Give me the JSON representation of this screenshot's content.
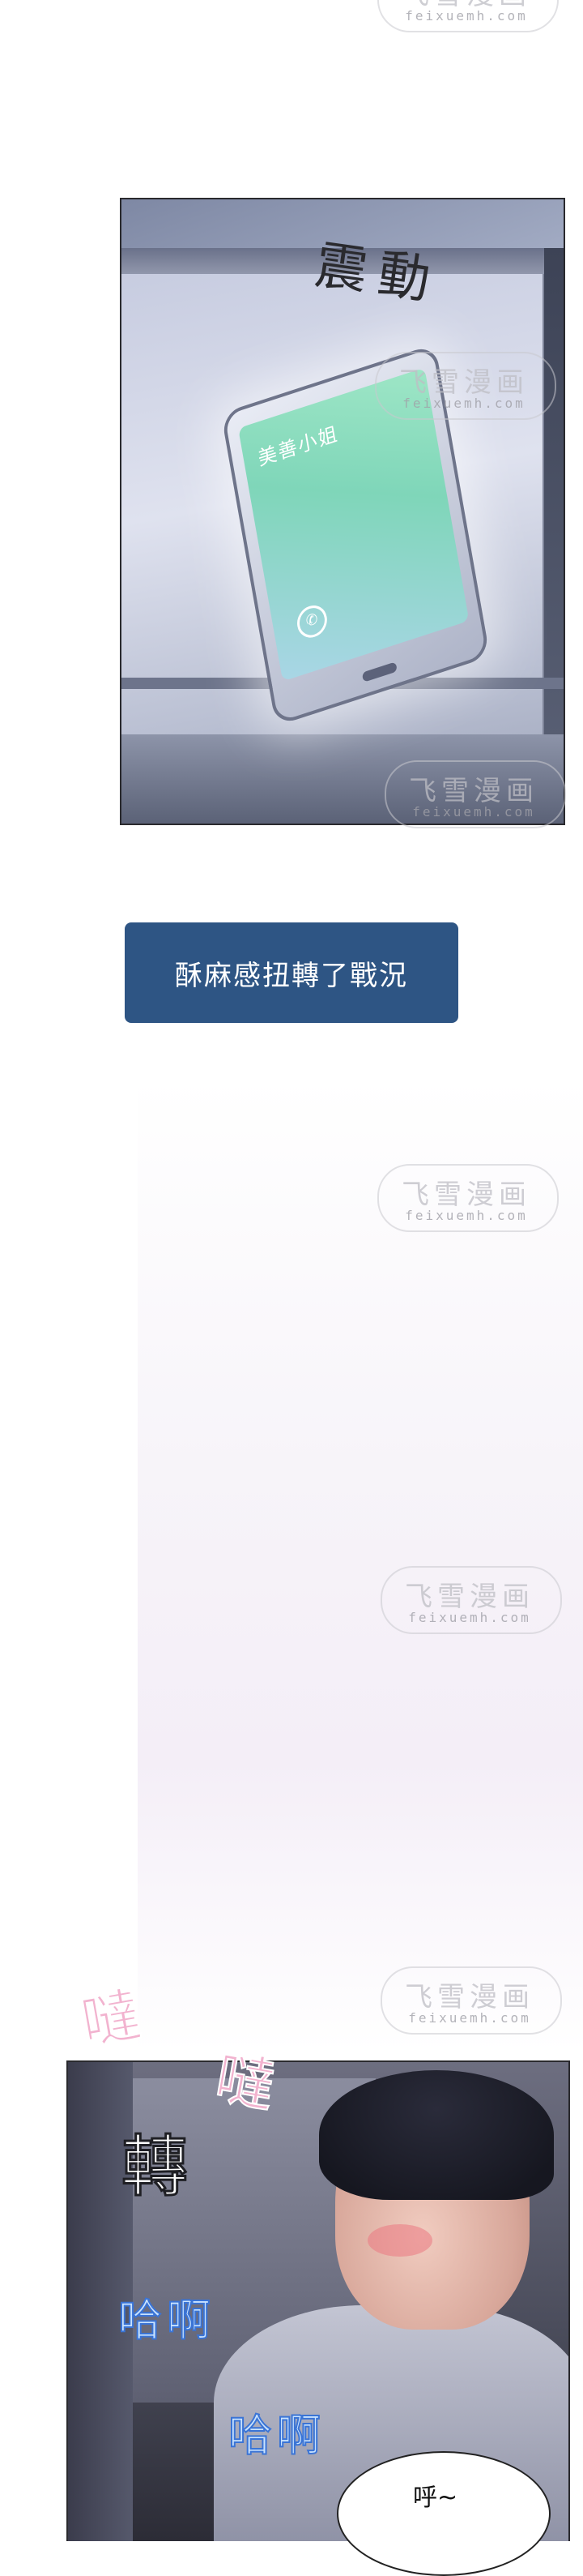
{
  "watermark": {
    "cn": "飞雪漫画",
    "en": "feixuemh.com"
  },
  "panel1": {
    "sfx": "震動",
    "phone_caller": "美善小姐",
    "icons": [
      "phone-icon"
    ]
  },
  "caption": {
    "text": "酥麻感扭轉了戰況"
  },
  "panel2": {
    "sfx_pink": [
      "噠",
      "噠"
    ],
    "sfx_turn": "轉",
    "sfx_blue": [
      "哈啊",
      "哈啊"
    ],
    "bubble_text": "呼~"
  },
  "colors": {
    "caption_bg": "#2e5584",
    "sfx_pink": "#f2b3cf",
    "sfx_blue": "#3a74d6"
  }
}
